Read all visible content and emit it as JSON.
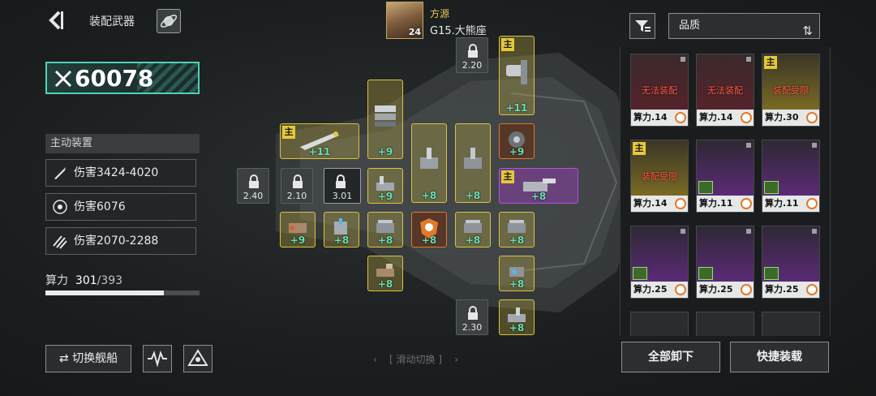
{
  "header": {
    "title": "装配武器"
  },
  "power": {
    "value": "60078"
  },
  "active_panel": {
    "title": "主动装置",
    "stats": [
      "伤害3424-4020",
      "伤害6076",
      "伤害2070-2288"
    ]
  },
  "compute": {
    "label": "算力",
    "current": "301",
    "max": "/393",
    "fill_ratio": 0.766
  },
  "captain": {
    "name": "方源",
    "level": "24",
    "ship": "G15.大熊座"
  },
  "bottom_left": {
    "switch_label": "切换舰船"
  },
  "slide_hint": "[ 滑动切换 ]",
  "grid": {
    "locks": [
      "2.20",
      "2.40",
      "2.10",
      "3.01",
      "2.30"
    ],
    "main_tag": "主",
    "slot_levels": [
      "+11",
      "+9",
      "+11",
      "+9",
      "+9",
      "+8",
      "+8",
      "+8",
      "+9",
      "+8",
      "+8",
      "+8",
      "+8",
      "+8",
      "+8",
      "+8",
      "+8",
      "+8"
    ]
  },
  "inventory": {
    "sort_label": "品质",
    "cards": [
      {
        "cp": "算力.14",
        "warn": "无法装配"
      },
      {
        "cp": "算力.14",
        "warn": "无法装配"
      },
      {
        "cp": "算力.30",
        "warn": "装配受限"
      },
      {
        "cp": "算力.14",
        "warn": "装配受限"
      },
      {
        "cp": "算力.11",
        "warn": ""
      },
      {
        "cp": "算力.11",
        "warn": ""
      },
      {
        "cp": "算力.25",
        "warn": ""
      },
      {
        "cp": "算力.25",
        "warn": ""
      },
      {
        "cp": "算力.25",
        "warn": ""
      }
    ],
    "unequip_all": "全部卸下",
    "quick_equip": "快捷装载"
  },
  "colors": {
    "accent_teal": "#4fd2b8",
    "slot_gold": "#d9c340",
    "slot_purple": "#b84de0",
    "level_green": "#68e0b2"
  }
}
